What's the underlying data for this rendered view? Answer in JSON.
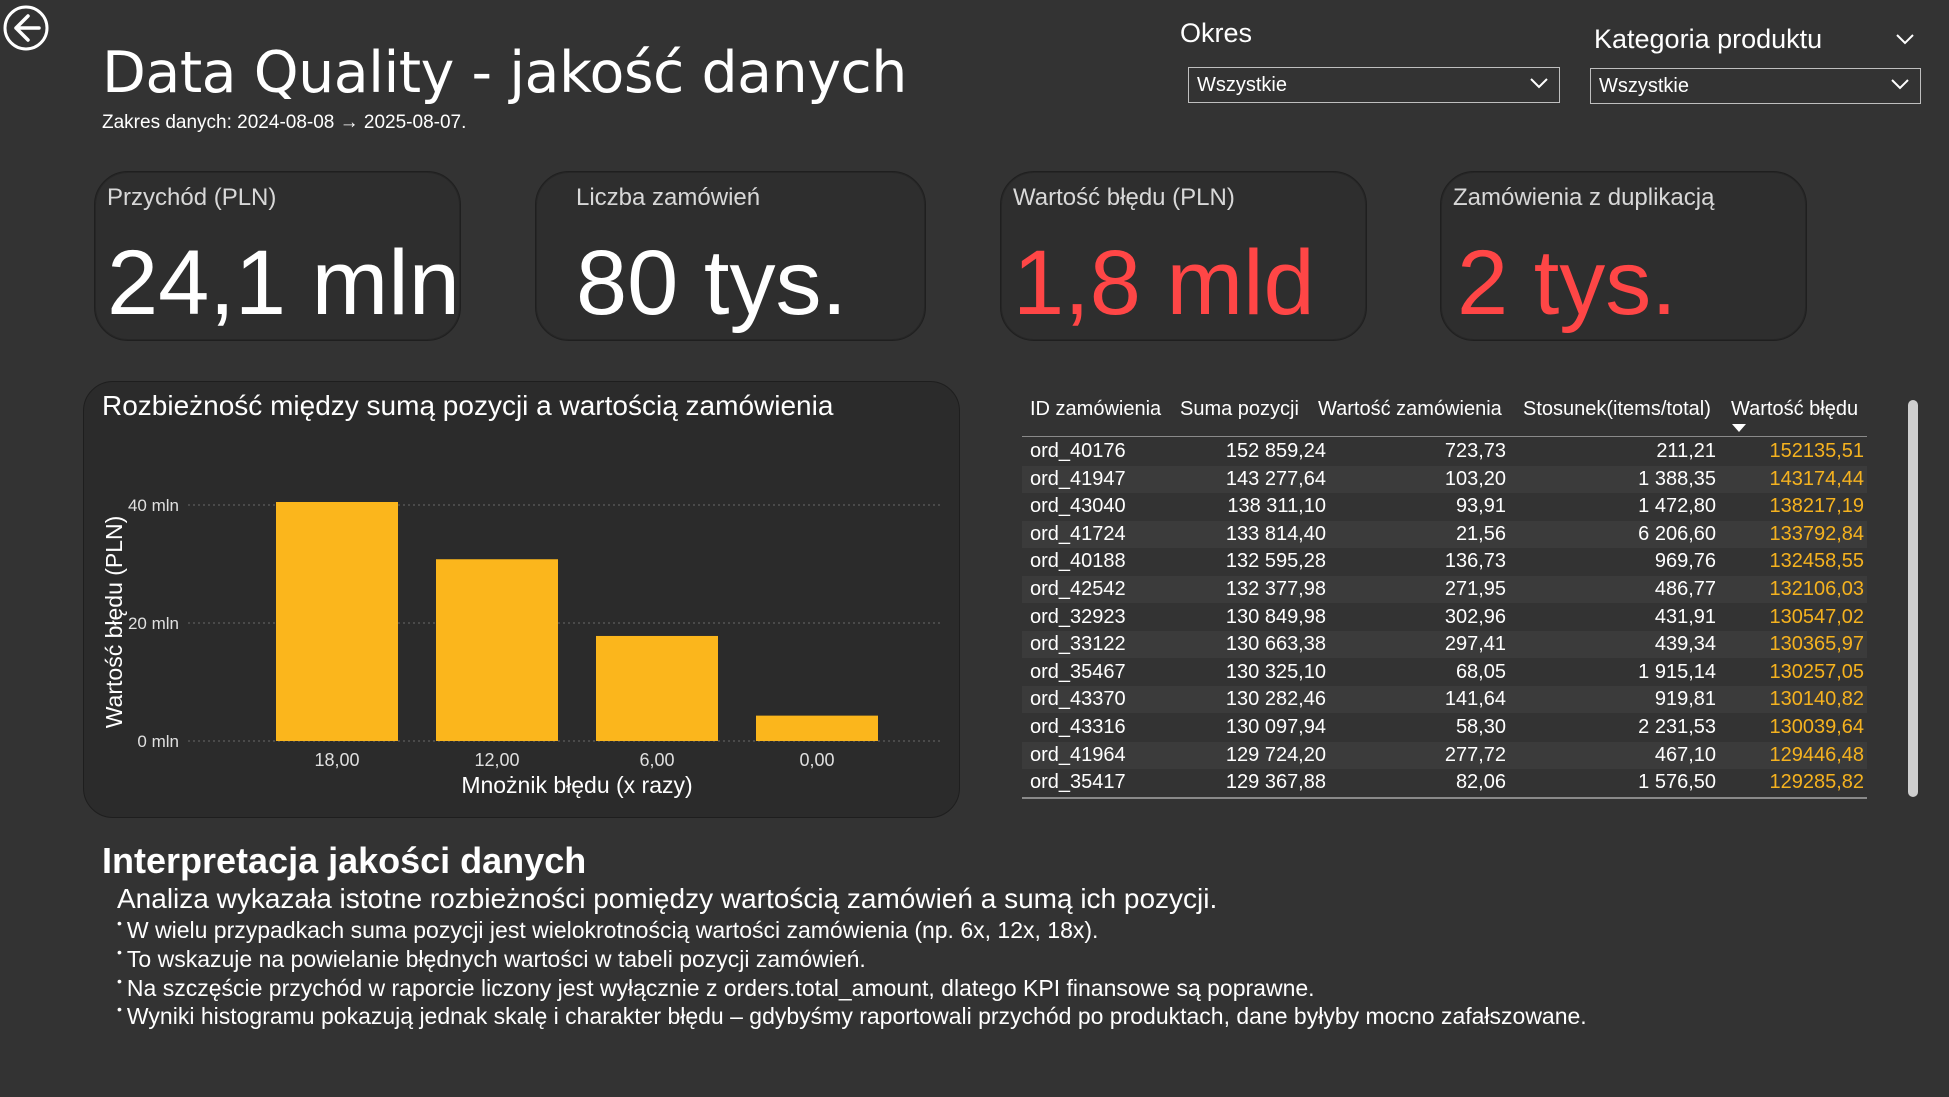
{
  "page": {
    "title": "Data Quality - jakość danych",
    "date_range": "Zakres danych: 2024-08-08 → 2025-08-07."
  },
  "filters": {
    "period": {
      "label": "Okres",
      "value": "Wszystkie"
    },
    "category": {
      "label": "Kategoria produktu",
      "value": "Wszystkie"
    }
  },
  "kpis": [
    {
      "label": "Przychód (PLN)",
      "value": "24,1 mln",
      "color": "#ffffff"
    },
    {
      "label": "Liczba zamówień",
      "value": "80 tys.",
      "color": "#ffffff"
    },
    {
      "label": "Wartość błędu (PLN)",
      "value": "1,8 mld",
      "color": "#ff4646"
    },
    {
      "label": "Zamówienia z duplikacją",
      "value": "2 tys.",
      "color": "#ff4646"
    }
  ],
  "chart_data": {
    "type": "bar",
    "title": "Rozbieżność między sumą pozycji a wartością zamówienia",
    "xlabel": "Mnożnik błędu (x razy)",
    "ylabel": "Wartość błędu (PLN)",
    "categories": [
      "18,00",
      "12,00",
      "6,00",
      "0,00"
    ],
    "values": [
      40.5,
      30.8,
      17.8,
      4.3
    ],
    "y_ticks": [
      {
        "value": 0,
        "label": "0 mln"
      },
      {
        "value": 20,
        "label": "20 mln"
      },
      {
        "value": 40,
        "label": "40 mln"
      }
    ],
    "ylim": [
      0,
      40.5
    ],
    "grid": true,
    "bar_color": "#fbb61c"
  },
  "table": {
    "headers": [
      "ID zamówienia",
      "Suma pozycji",
      "Wartość zamówienia",
      "Stosunek(items/total)",
      "Wartość błędu"
    ],
    "rows": [
      [
        "ord_40176",
        "152 859,24",
        "723,73",
        "211,21",
        "152135,51"
      ],
      [
        "ord_41947",
        "143 277,64",
        "103,20",
        "1 388,35",
        "143174,44"
      ],
      [
        "ord_43040",
        "138 311,10",
        "93,91",
        "1 472,80",
        "138217,19"
      ],
      [
        "ord_41724",
        "133 814,40",
        "21,56",
        "6 206,60",
        "133792,84"
      ],
      [
        "ord_40188",
        "132 595,28",
        "136,73",
        "969,76",
        "132458,55"
      ],
      [
        "ord_42542",
        "132 377,98",
        "271,95",
        "486,77",
        "132106,03"
      ],
      [
        "ord_32923",
        "130 849,98",
        "302,96",
        "431,91",
        "130547,02"
      ],
      [
        "ord_33122",
        "130 663,38",
        "297,41",
        "439,34",
        "130365,97"
      ],
      [
        "ord_35467",
        "130 325,10",
        "68,05",
        "1 915,14",
        "130257,05"
      ],
      [
        "ord_43370",
        "130 282,46",
        "141,64",
        "919,81",
        "130140,82"
      ],
      [
        "ord_43316",
        "130 097,94",
        "58,30",
        "2 231,53",
        "130039,64"
      ],
      [
        "ord_41964",
        "129 724,20",
        "277,72",
        "467,10",
        "129446,48"
      ],
      [
        "ord_35417",
        "129 367,88",
        "82,06",
        "1 576,50",
        "129285,82"
      ]
    ]
  },
  "interpretation": {
    "title": "Interpretacja jakości danych",
    "intro": "Analiza wykazała istotne rozbieżności pomiędzy wartością zamówień a sumą ich pozycji.",
    "bullets": [
      "W wielu przypadkach suma pozycji jest wielokrotnością wartości zamówienia (np. 6x, 12x, 18x).",
      "To wskazuje na powielanie błędnych wartości w tabeli pozycji zamówień.",
      "Na szczęście przychód w raporcie liczony jest wyłącznie z orders.total_amount, dlatego KPI finansowe są poprawne.",
      "Wyniki histogramu pokazują jednak skalę i charakter błędu – gdybyśmy raportowali przychód po produktach, dane byłyby mocno zafałszowane."
    ]
  }
}
